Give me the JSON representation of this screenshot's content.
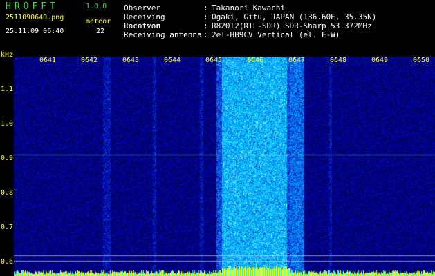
{
  "header": {
    "logo": "HROFFT",
    "version": "1.0.0",
    "filename": "2511090640.png",
    "datetime": "25.11.09 06:40",
    "meteor_label": "meteor",
    "meteor_count": "22"
  },
  "info": [
    {
      "key": "Observer",
      "value": "Takanori Kawachi"
    },
    {
      "key": "Receiving Location",
      "value": "Ogaki, Gifu, JAPAN (136.60E, 35.35N)"
    },
    {
      "key": "Receiver",
      "value": "R820T2(RTL-SDR) SDR-Sharp 53.372MHz"
    },
    {
      "key": "Receiving antenna",
      "value": "2el-HB9CV Vertical (el. E-W)"
    }
  ],
  "axis": {
    "y_unit": "kHz",
    "y_ticks": [
      "1.1",
      "1.0",
      "0.9",
      "0.8",
      "0.7",
      "0.6"
    ],
    "x_ticks": [
      "0641",
      "0642",
      "0643",
      "0644",
      "0645",
      "0646",
      "0647",
      "0648",
      "0649",
      "0650"
    ]
  },
  "colors": {
    "background": "#000000",
    "text_green": "#3ddc3d",
    "text_white": "#ffffff",
    "axis_yellow": "#ffff33",
    "waterfall_low": "#000066",
    "waterfall_high": "#00ffff"
  }
}
